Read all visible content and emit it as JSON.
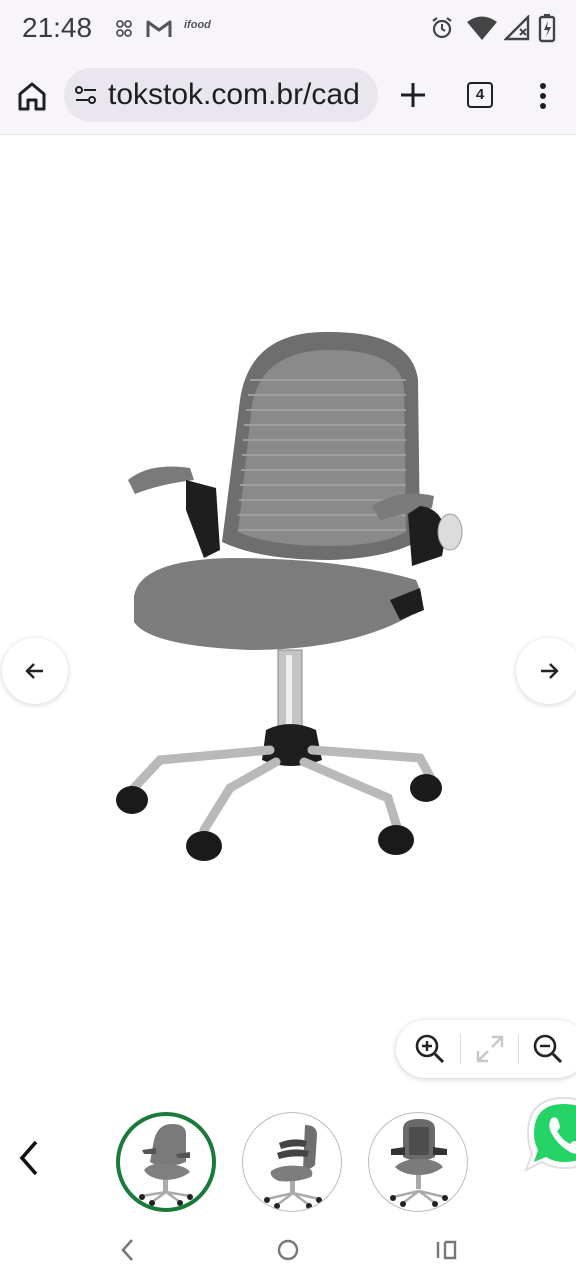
{
  "status": {
    "time": "21:48",
    "notif_icons": [
      "dots-icon",
      "gmail-icon",
      "ifood-icon"
    ],
    "ifood_text": "ifood",
    "right_icons": [
      "alarm-icon",
      "wifi-icon",
      "signal-icon",
      "battery-icon"
    ]
  },
  "browser": {
    "url": "tokstok.com.br/cad",
    "tab_count": "4"
  },
  "product": {
    "image_name": "office-chair-gray"
  },
  "colors": {
    "accent_green": "#1a7a3a",
    "whatsapp_green": "#25d366",
    "chrome_bg": "#f7f5fa"
  }
}
